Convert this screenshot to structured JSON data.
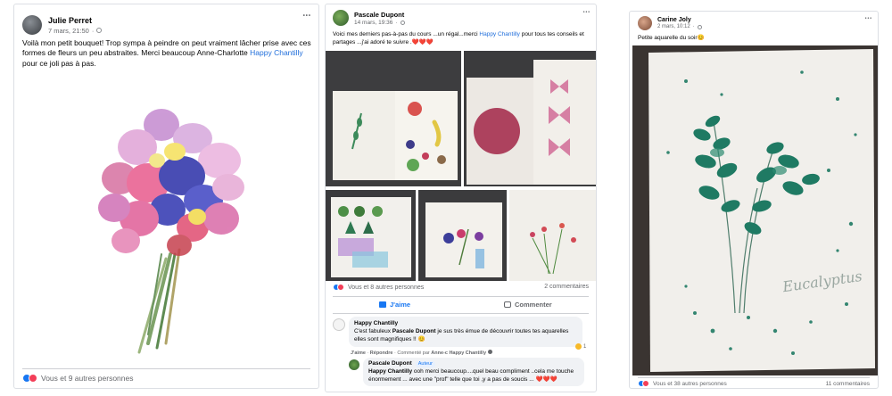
{
  "post1": {
    "author": "Julie Perret",
    "time": "7 mars, 21:50",
    "text_before": "Voilà mon petit bouquet! Trop sympa à peindre on peut vraiment lâcher prise avec ces formes de fleurs un peu abstraites. Merci beaucoup Anne-Charlotte ",
    "link": "Happy Chantilly",
    "text_after": " pour ce joli pas à pas.",
    "reactions": "Vous et 9 autres personnes",
    "more_icon": "•••"
  },
  "post2": {
    "author": "Pascale Dupont",
    "time": "14 mars, 19:36",
    "text_before": "Voici mes derniers pas-à-pas du cours ...un régal...merci ",
    "link": "Happy Chantilly",
    "text_after": " pour tous tes conseils et partages ...j'ai adoré te suivre .",
    "hearts": "❤️❤️❤️",
    "reactions": "Vous et 8 autres personnes",
    "comments_count": "2 commentaires",
    "like_label": "J'aime",
    "comment_label": "Commenter",
    "more_icon": "•••",
    "comment1": {
      "author": "Happy Chantilly",
      "text_before": "C'est fabuleux ",
      "mention": "Pascale Dupont",
      "text_after": " je sus très émue de découvrir toutes tes aquarelles elles sont magnifiques !! 😊",
      "action_like": "J'aime",
      "action_reply": "Répondre",
      "action_commented": "Commenté par",
      "action_by": "Anne-c Happy Chantilly",
      "reaction_count": "1"
    },
    "comment2": {
      "author": "Pascale Dupont",
      "badge": "Auteur",
      "mention": "Happy Chantilly",
      "text_after": " ooh merci beaucoup....quel beau compliment ..cela me touche énormement ... avec une \"prof\" telle que toi ,y a pas de soucis ...",
      "hearts": "❤️❤️❤️"
    }
  },
  "post3": {
    "author": "Carine Joly",
    "time": "2 mars, 10:12",
    "text": "Petite aquarelle du soir😊",
    "watermark": "Eucalyptus",
    "reactions": "Vous et 38 autres personnes",
    "comments_count": "11 commentaires",
    "more_icon": "•••"
  },
  "colors": {
    "link": "#216fdb",
    "like_blue": "#1877f2",
    "love_red": "#f33e58",
    "secondary_text": "#65676b"
  }
}
